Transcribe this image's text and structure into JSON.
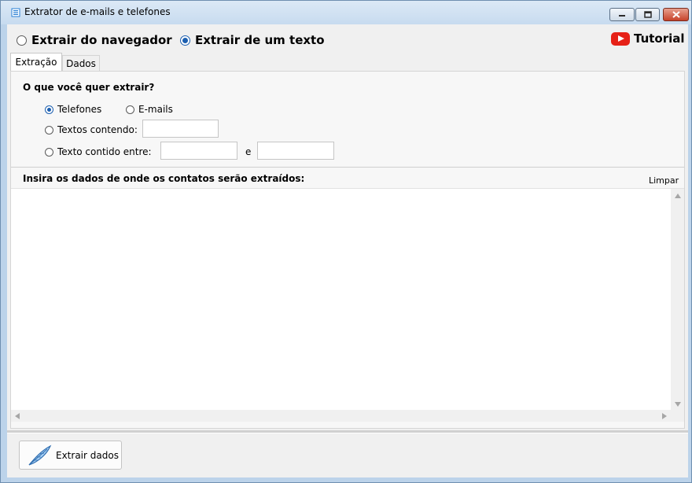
{
  "window": {
    "title": "Extrator de e-mails e telefones"
  },
  "mode": {
    "browser_label": "Extrair do navegador",
    "text_label": "Extrair de um texto",
    "selected": "text"
  },
  "tutorial": {
    "label": "Tutorial",
    "icon": "youtube-play-icon"
  },
  "tabs": [
    {
      "label": "Extração",
      "active": true
    },
    {
      "label": "Dados",
      "active": false
    }
  ],
  "extraction": {
    "question": "O que você quer extrair?",
    "phones_label": "Telefones",
    "emails_label": "E-mails",
    "contains_label": "Textos contendo:",
    "contains_value": "",
    "between_label": "Texto contido entre:",
    "between_start_value": "",
    "between_and": "e",
    "between_end_value": "",
    "selected": "phones"
  },
  "input_section": {
    "label": "Insira  os dados de onde os contatos serão extraídos:",
    "clear_label": "Limpar",
    "content": ""
  },
  "footer": {
    "extract_button_label": "Extrair dados",
    "extract_icon": "feather-icon"
  },
  "colors": {
    "accent": "#1c5fb0",
    "youtube_red": "#e62117",
    "close_button": "#c7422a"
  }
}
